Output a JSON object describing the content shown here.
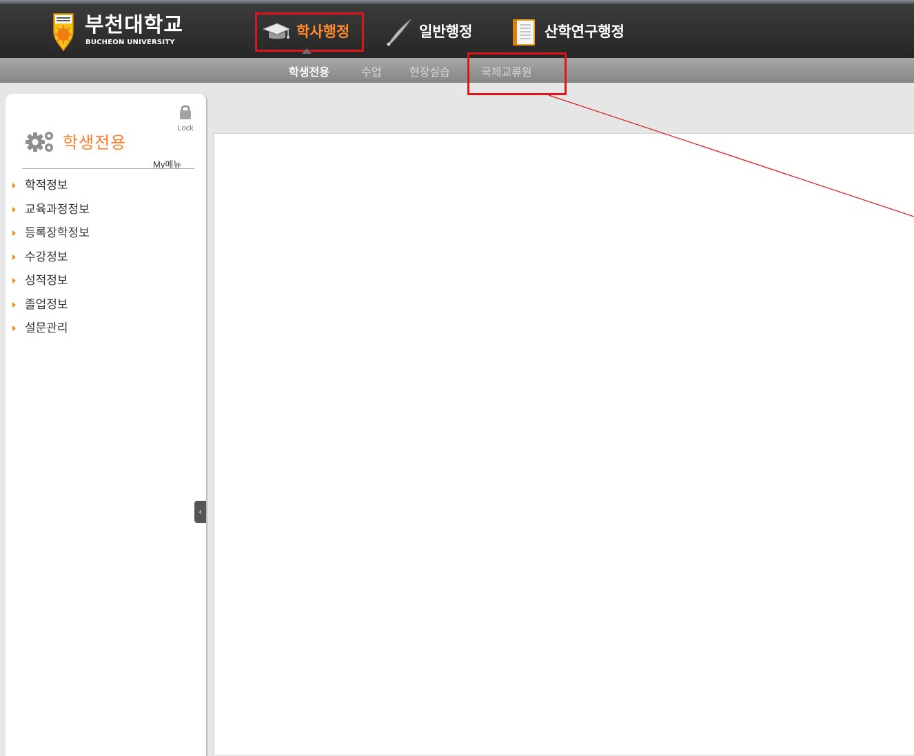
{
  "header": {
    "logo_title": "부천대학교",
    "logo_subtitle": "BUCHEON UNIVERSITY",
    "top_nav": [
      {
        "label": "학사행정",
        "icon": "graduation-cap-icon"
      },
      {
        "label": "일반행정",
        "icon": "quill-pen-icon"
      },
      {
        "label": "산학연구행정",
        "icon": "book-icon"
      }
    ],
    "active_top_nav": "학사행정",
    "sub_nav": [
      "학생전용",
      "수업",
      "현장실습",
      "국제교류원"
    ],
    "active_sub_nav": "학생전용"
  },
  "sidebar": {
    "lock_label": "Lock",
    "section_title": "학생전용",
    "my_menu_label": "My메뉴",
    "items": [
      "학적정보",
      "교육과정정보",
      "등록장학정보",
      "수강정보",
      "성적정보",
      "졸업정보",
      "설문관리"
    ]
  },
  "colors": {
    "accent_orange": "#ff7e2a",
    "annotation_red": "#e0151b",
    "header_dark": "#2f2f2f",
    "subnav_gray": "#969696"
  }
}
